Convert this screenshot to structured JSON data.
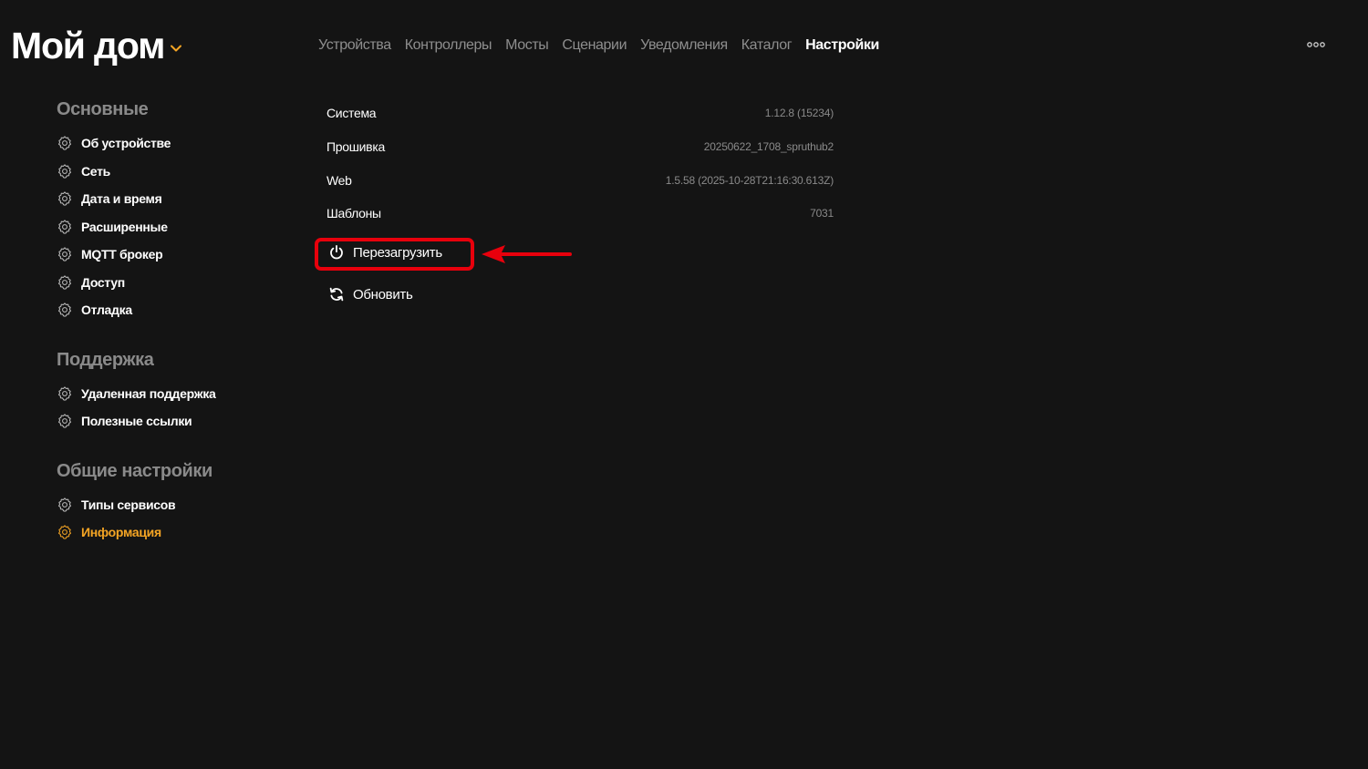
{
  "header": {
    "title": "Мой дом",
    "tabs": [
      {
        "label": "Устройства",
        "active": false
      },
      {
        "label": "Контроллеры",
        "active": false
      },
      {
        "label": "Мосты",
        "active": false
      },
      {
        "label": "Сценарии",
        "active": false
      },
      {
        "label": "Уведомления",
        "active": false
      },
      {
        "label": "Каталог",
        "active": false
      },
      {
        "label": "Настройки",
        "active": true
      }
    ],
    "more_icon": "more-dots-icon"
  },
  "sidebar": {
    "sections": [
      {
        "title": "Основные",
        "items": [
          {
            "label": "Об устройстве"
          },
          {
            "label": "Сеть"
          },
          {
            "label": "Дата и время"
          },
          {
            "label": "Расширенные"
          },
          {
            "label": "MQTT брокер"
          },
          {
            "label": "Доступ"
          },
          {
            "label": "Отладка"
          }
        ]
      },
      {
        "title": "Поддержка",
        "items": [
          {
            "label": "Удаленная поддержка"
          },
          {
            "label": "Полезные ссылки"
          }
        ]
      },
      {
        "title": "Общие настройки",
        "items": [
          {
            "label": "Типы сервисов"
          },
          {
            "label": "Информация",
            "active": true
          }
        ]
      }
    ],
    "item_icon": "gear-icon"
  },
  "info": {
    "rows": [
      {
        "key": "Система",
        "value": "1.12.8 (15234)"
      },
      {
        "key": "Прошивка",
        "value": "20250622_1708_spruthub2"
      },
      {
        "key": "Web",
        "value": "1.5.58 (2025-10-28T21:16:30.613Z)"
      },
      {
        "key": "Шаблоны",
        "value": "7031"
      }
    ]
  },
  "actions": {
    "reboot_label": "Перезагрузить",
    "reboot_icon": "power-icon",
    "refresh_label": "Обновить",
    "refresh_icon": "refresh-icon"
  },
  "colors": {
    "background": "#141414",
    "accent": "#f5a524",
    "muted": "#8a8a8a",
    "annotation": "#e8000c"
  }
}
